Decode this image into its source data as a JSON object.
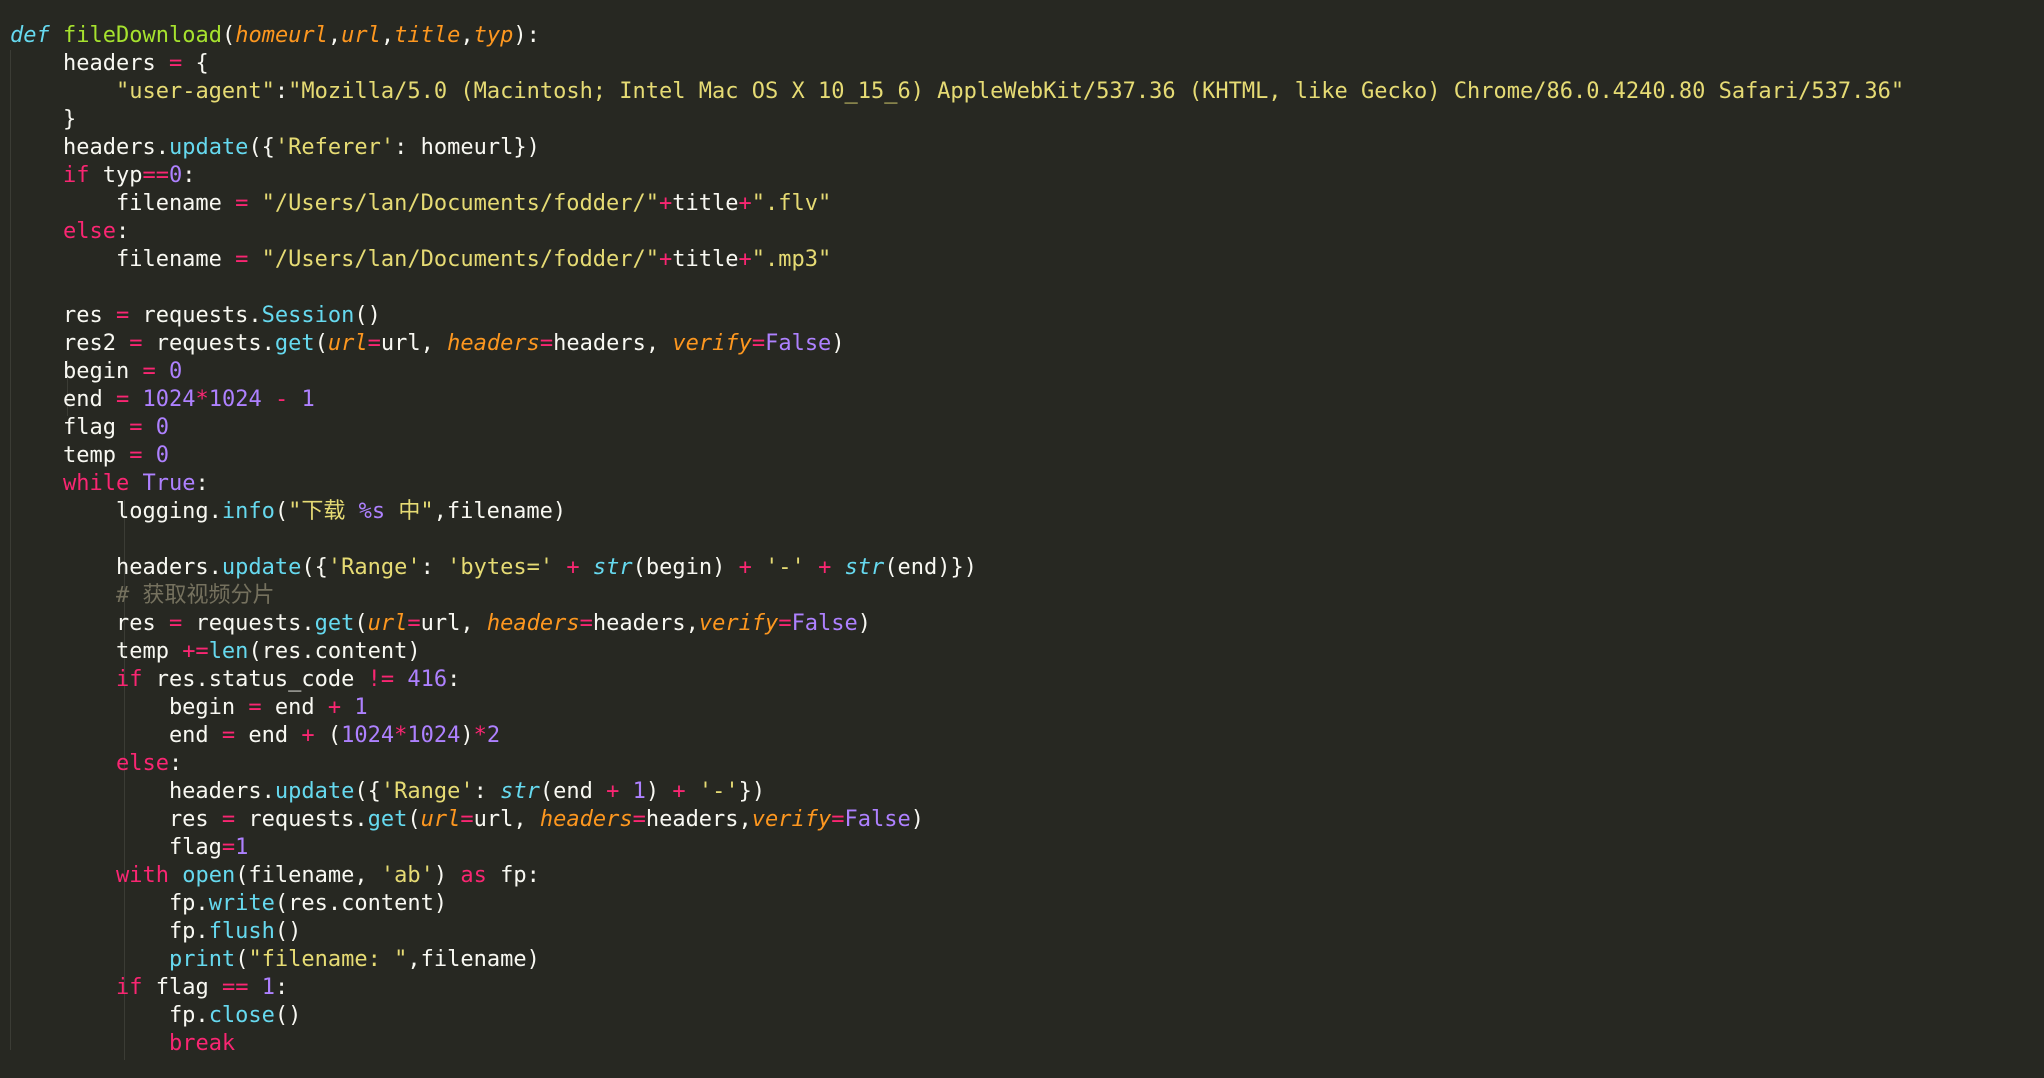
{
  "theme": {
    "background": "#272822",
    "colors": {
      "plain": "#f8f8f2",
      "keyword": "#f92672",
      "storage": "#66d9ef",
      "function": "#a6e22e",
      "parameter": "#fd971f",
      "string": "#e6db74",
      "number": "#ae81ff",
      "comment": "#75715e"
    }
  },
  "code": {
    "language": "python",
    "lines": [
      [
        [
          "storage",
          "def"
        ],
        [
          "plain",
          " "
        ],
        [
          "func",
          "fileDownload"
        ],
        [
          "plain",
          "("
        ],
        [
          "param",
          "homeurl"
        ],
        [
          "plain",
          ","
        ],
        [
          "param",
          "url"
        ],
        [
          "plain",
          ","
        ],
        [
          "param",
          "title"
        ],
        [
          "plain",
          ","
        ],
        [
          "param",
          "typ"
        ],
        [
          "plain",
          "):"
        ]
      ],
      [
        [
          "plain",
          "    headers "
        ],
        [
          "op",
          "="
        ],
        [
          "plain",
          " {"
        ]
      ],
      [
        [
          "plain",
          "        "
        ],
        [
          "string",
          "\"user-agent\""
        ],
        [
          "plain",
          ":"
        ],
        [
          "string",
          "\"Mozilla/5.0 (Macintosh; Intel Mac OS X 10_15_6) AppleWebKit/537.36 (KHTML, like Gecko) Chrome/86.0.4240.80 Safari/537.36\""
        ]
      ],
      [
        [
          "plain",
          "    }"
        ]
      ],
      [
        [
          "plain",
          "    headers."
        ],
        [
          "call",
          "update"
        ],
        [
          "plain",
          "({"
        ],
        [
          "string",
          "'Referer'"
        ],
        [
          "plain",
          ": homeurl})"
        ]
      ],
      [
        [
          "plain",
          "    "
        ],
        [
          "kw",
          "if"
        ],
        [
          "plain",
          " typ"
        ],
        [
          "op",
          "=="
        ],
        [
          "num",
          "0"
        ],
        [
          "plain",
          ":"
        ]
      ],
      [
        [
          "plain",
          "        filename "
        ],
        [
          "op",
          "="
        ],
        [
          "plain",
          " "
        ],
        [
          "string",
          "\"/Users/lan/Documents/fodder/\""
        ],
        [
          "op",
          "+"
        ],
        [
          "plain",
          "title"
        ],
        [
          "op",
          "+"
        ],
        [
          "string",
          "\".flv\""
        ]
      ],
      [
        [
          "plain",
          "    "
        ],
        [
          "kw",
          "else"
        ],
        [
          "plain",
          ":"
        ]
      ],
      [
        [
          "plain",
          "        filename "
        ],
        [
          "op",
          "="
        ],
        [
          "plain",
          " "
        ],
        [
          "string",
          "\"/Users/lan/Documents/fodder/\""
        ],
        [
          "op",
          "+"
        ],
        [
          "plain",
          "title"
        ],
        [
          "op",
          "+"
        ],
        [
          "string",
          "\".mp3\""
        ]
      ],
      [
        [
          "plain",
          ""
        ]
      ],
      [
        [
          "plain",
          "    res "
        ],
        [
          "op",
          "="
        ],
        [
          "plain",
          " requests."
        ],
        [
          "call",
          "Session"
        ],
        [
          "plain",
          "()"
        ]
      ],
      [
        [
          "plain",
          "    res2 "
        ],
        [
          "op",
          "="
        ],
        [
          "plain",
          " requests."
        ],
        [
          "call",
          "get"
        ],
        [
          "plain",
          "("
        ],
        [
          "param",
          "url"
        ],
        [
          "op",
          "="
        ],
        [
          "plain",
          "url, "
        ],
        [
          "param",
          "headers"
        ],
        [
          "op",
          "="
        ],
        [
          "plain",
          "headers, "
        ],
        [
          "param",
          "verify"
        ],
        [
          "op",
          "="
        ],
        [
          "const",
          "False"
        ],
        [
          "plain",
          ")"
        ]
      ],
      [
        [
          "plain",
          "    begin "
        ],
        [
          "op",
          "="
        ],
        [
          "plain",
          " "
        ],
        [
          "num",
          "0"
        ]
      ],
      [
        [
          "plain",
          "    end "
        ],
        [
          "op",
          "="
        ],
        [
          "plain",
          " "
        ],
        [
          "num",
          "1024"
        ],
        [
          "op",
          "*"
        ],
        [
          "num",
          "1024"
        ],
        [
          "plain",
          " "
        ],
        [
          "op",
          "-"
        ],
        [
          "plain",
          " "
        ],
        [
          "num",
          "1"
        ]
      ],
      [
        [
          "plain",
          "    flag "
        ],
        [
          "op",
          "="
        ],
        [
          "plain",
          " "
        ],
        [
          "num",
          "0"
        ]
      ],
      [
        [
          "plain",
          "    temp "
        ],
        [
          "op",
          "="
        ],
        [
          "plain",
          " "
        ],
        [
          "num",
          "0"
        ]
      ],
      [
        [
          "plain",
          "    "
        ],
        [
          "kw",
          "while"
        ],
        [
          "plain",
          " "
        ],
        [
          "const",
          "True"
        ],
        [
          "plain",
          ":"
        ]
      ],
      [
        [
          "plain",
          "        logging."
        ],
        [
          "call",
          "info"
        ],
        [
          "plain",
          "("
        ],
        [
          "string",
          "\"下载 "
        ],
        [
          "num",
          "%s"
        ],
        [
          "string",
          " 中\""
        ],
        [
          "plain",
          ",filename)"
        ]
      ],
      [
        [
          "plain",
          ""
        ]
      ],
      [
        [
          "plain",
          "        headers."
        ],
        [
          "call",
          "update"
        ],
        [
          "plain",
          "({"
        ],
        [
          "string",
          "'Range'"
        ],
        [
          "plain",
          ": "
        ],
        [
          "string",
          "'bytes='"
        ],
        [
          "plain",
          " "
        ],
        [
          "op",
          "+"
        ],
        [
          "plain",
          " "
        ],
        [
          "builtin",
          "str"
        ],
        [
          "plain",
          "(begin) "
        ],
        [
          "op",
          "+"
        ],
        [
          "plain",
          " "
        ],
        [
          "string",
          "'-'"
        ],
        [
          "plain",
          " "
        ],
        [
          "op",
          "+"
        ],
        [
          "plain",
          " "
        ],
        [
          "builtin",
          "str"
        ],
        [
          "plain",
          "(end)})"
        ]
      ],
      [
        [
          "plain",
          "        "
        ],
        [
          "comment",
          "# 获取视频分片"
        ]
      ],
      [
        [
          "plain",
          "        res "
        ],
        [
          "op",
          "="
        ],
        [
          "plain",
          " requests."
        ],
        [
          "call",
          "get"
        ],
        [
          "plain",
          "("
        ],
        [
          "param",
          "url"
        ],
        [
          "op",
          "="
        ],
        [
          "plain",
          "url, "
        ],
        [
          "param",
          "headers"
        ],
        [
          "op",
          "="
        ],
        [
          "plain",
          "headers,"
        ],
        [
          "param",
          "verify"
        ],
        [
          "op",
          "="
        ],
        [
          "const",
          "False"
        ],
        [
          "plain",
          ")"
        ]
      ],
      [
        [
          "plain",
          "        temp "
        ],
        [
          "op",
          "+="
        ],
        [
          "call",
          "len"
        ],
        [
          "plain",
          "(res.content)"
        ]
      ],
      [
        [
          "plain",
          "        "
        ],
        [
          "kw",
          "if"
        ],
        [
          "plain",
          " res.status_code "
        ],
        [
          "op",
          "!="
        ],
        [
          "plain",
          " "
        ],
        [
          "num",
          "416"
        ],
        [
          "plain",
          ":"
        ]
      ],
      [
        [
          "plain",
          "            begin "
        ],
        [
          "op",
          "="
        ],
        [
          "plain",
          " end "
        ],
        [
          "op",
          "+"
        ],
        [
          "plain",
          " "
        ],
        [
          "num",
          "1"
        ]
      ],
      [
        [
          "plain",
          "            end "
        ],
        [
          "op",
          "="
        ],
        [
          "plain",
          " end "
        ],
        [
          "op",
          "+"
        ],
        [
          "plain",
          " ("
        ],
        [
          "num",
          "1024"
        ],
        [
          "op",
          "*"
        ],
        [
          "num",
          "1024"
        ],
        [
          "plain",
          ")"
        ],
        [
          "op",
          "*"
        ],
        [
          "num",
          "2"
        ]
      ],
      [
        [
          "plain",
          "        "
        ],
        [
          "kw",
          "else"
        ],
        [
          "plain",
          ":"
        ]
      ],
      [
        [
          "plain",
          "            headers."
        ],
        [
          "call",
          "update"
        ],
        [
          "plain",
          "({"
        ],
        [
          "string",
          "'Range'"
        ],
        [
          "plain",
          ": "
        ],
        [
          "builtin",
          "str"
        ],
        [
          "plain",
          "(end "
        ],
        [
          "op",
          "+"
        ],
        [
          "plain",
          " "
        ],
        [
          "num",
          "1"
        ],
        [
          "plain",
          ") "
        ],
        [
          "op",
          "+"
        ],
        [
          "plain",
          " "
        ],
        [
          "string",
          "'-'"
        ],
        [
          "plain",
          "})"
        ]
      ],
      [
        [
          "plain",
          "            res "
        ],
        [
          "op",
          "="
        ],
        [
          "plain",
          " requests."
        ],
        [
          "call",
          "get"
        ],
        [
          "plain",
          "("
        ],
        [
          "param",
          "url"
        ],
        [
          "op",
          "="
        ],
        [
          "plain",
          "url, "
        ],
        [
          "param",
          "headers"
        ],
        [
          "op",
          "="
        ],
        [
          "plain",
          "headers,"
        ],
        [
          "param",
          "verify"
        ],
        [
          "op",
          "="
        ],
        [
          "const",
          "False"
        ],
        [
          "plain",
          ")"
        ]
      ],
      [
        [
          "plain",
          "            flag"
        ],
        [
          "op",
          "="
        ],
        [
          "num",
          "1"
        ]
      ],
      [
        [
          "plain",
          "        "
        ],
        [
          "kw",
          "with"
        ],
        [
          "plain",
          " "
        ],
        [
          "call",
          "open"
        ],
        [
          "plain",
          "(filename, "
        ],
        [
          "string",
          "'ab'"
        ],
        [
          "plain",
          ") "
        ],
        [
          "kw",
          "as"
        ],
        [
          "plain",
          " fp:"
        ]
      ],
      [
        [
          "plain",
          "            fp."
        ],
        [
          "call",
          "write"
        ],
        [
          "plain",
          "(res.content)"
        ]
      ],
      [
        [
          "plain",
          "            fp."
        ],
        [
          "call",
          "flush"
        ],
        [
          "plain",
          "()"
        ]
      ],
      [
        [
          "plain",
          "            "
        ],
        [
          "call",
          "print"
        ],
        [
          "plain",
          "("
        ],
        [
          "string",
          "\"filename: \""
        ],
        [
          "plain",
          ",filename)"
        ]
      ],
      [
        [
          "plain",
          "        "
        ],
        [
          "kw",
          "if"
        ],
        [
          "plain",
          " flag "
        ],
        [
          "op",
          "=="
        ],
        [
          "plain",
          " "
        ],
        [
          "num",
          "1"
        ],
        [
          "plain",
          ":"
        ]
      ],
      [
        [
          "plain",
          "            fp."
        ],
        [
          "call",
          "close"
        ],
        [
          "plain",
          "()"
        ]
      ],
      [
        [
          "plain",
          "            "
        ],
        [
          "kw",
          "break"
        ]
      ]
    ]
  }
}
